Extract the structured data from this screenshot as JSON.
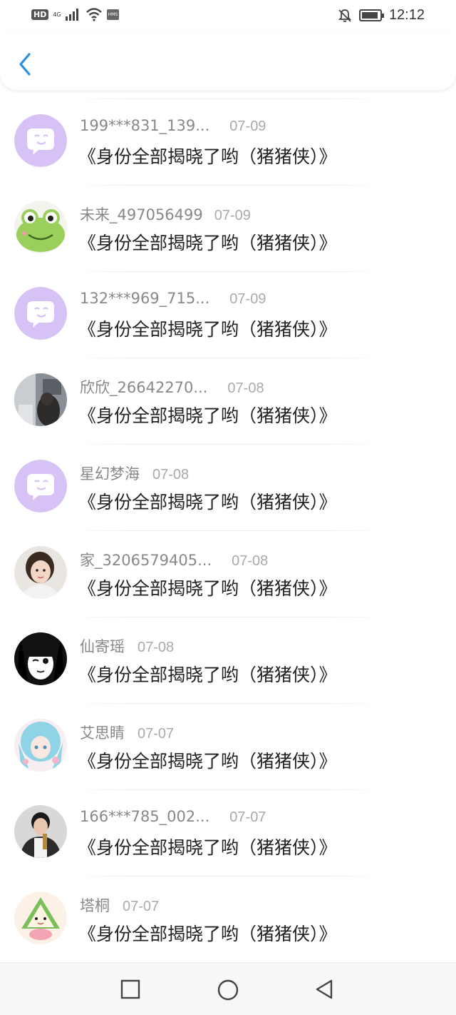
{
  "status_bar": {
    "hd": "HD",
    "network": "4G",
    "hms": "HMS",
    "time": "12:12"
  },
  "colors": {
    "back_arrow": "#2a8fe0",
    "name_text": "#888888",
    "date_text": "#aaaaaa",
    "message_text": "#222222",
    "purple_avatar": "#d6c2f5"
  },
  "header": {
    "back_icon": "chevron-left-icon"
  },
  "list": {
    "items": [
      {
        "name": "199***831_139...",
        "date": "07-09",
        "message": "《身份全部揭晓了哟（猪猪侠）》",
        "avatar": "purple-chat-icon"
      },
      {
        "name": "未来_497056499",
        "date": "07-09",
        "message": "《身份全部揭晓了哟（猪猪侠）》",
        "avatar": "frog-avatar"
      },
      {
        "name": "132***969_715...",
        "date": "07-09",
        "message": "《身份全部揭晓了哟（猪猪侠）》",
        "avatar": "purple-chat-icon"
      },
      {
        "name": "欣欣_26642270...",
        "date": "07-08",
        "message": "《身份全部揭晓了哟（猪猪侠）》",
        "avatar": "photo-avatar"
      },
      {
        "name": "星幻梦海",
        "date": "07-08",
        "message": "《身份全部揭晓了哟（猪猪侠）》",
        "avatar": "purple-chat-icon"
      },
      {
        "name": "家_3206579405...",
        "date": "07-08",
        "message": "《身份全部揭晓了哟（猪猪侠）》",
        "avatar": "child-photo-avatar"
      },
      {
        "name": "仙寄瑶",
        "date": "07-08",
        "message": "《身份全部揭晓了哟（猪猪侠）》",
        "avatar": "anime-bw-avatar"
      },
      {
        "name": "艾思睛",
        "date": "07-07",
        "message": "《身份全部揭晓了哟（猪猪侠）》",
        "avatar": "anime-blue-hair-avatar"
      },
      {
        "name": "166***785_002...",
        "date": "07-07",
        "message": "《身份全部揭晓了哟（猪猪侠）》",
        "avatar": "man-photo-avatar"
      },
      {
        "name": "塔桐",
        "date": "07-07",
        "message": "《身份全部揭晓了哟（猪猪侠）》",
        "avatar": "rice-dumpling-avatar"
      }
    ]
  },
  "nav_bar": {
    "recent": "square-icon",
    "home": "circle-icon",
    "back": "triangle-back-icon"
  }
}
